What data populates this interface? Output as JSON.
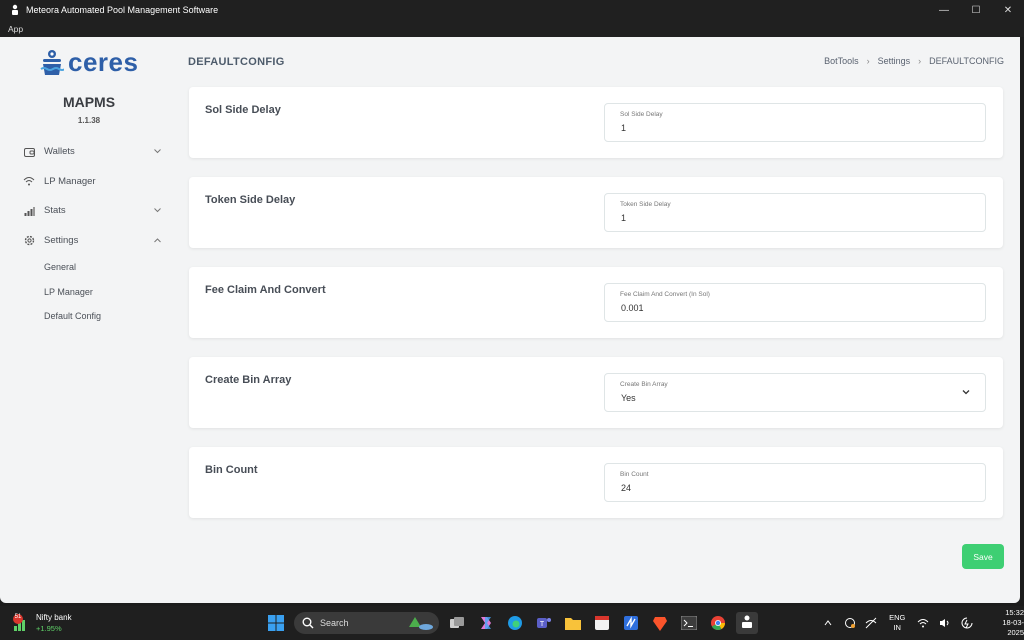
{
  "window": {
    "title": "Meteora Automated Pool Management Software"
  },
  "menu": {
    "app": "App"
  },
  "sidebar": {
    "brand": "ceres",
    "app_name": "MAPMS",
    "version": "1.1.38",
    "items": [
      {
        "label": "Wallets",
        "icon": "wallet-icon",
        "expandable": true
      },
      {
        "label": "LP Manager",
        "icon": "wifi-icon",
        "expandable": false
      },
      {
        "label": "Stats",
        "icon": "bar-chart-icon",
        "expandable": true
      },
      {
        "label": "Settings",
        "icon": "gear-icon",
        "expandable": true,
        "expanded": true
      }
    ],
    "subitems": [
      {
        "label": "General"
      },
      {
        "label": "LP Manager"
      },
      {
        "label": "Default Config"
      }
    ]
  },
  "header": {
    "title": "DEFAULTCONFIG",
    "breadcrumb": [
      "BotTools",
      "Settings",
      "DEFAULTCONFIG"
    ]
  },
  "settings": [
    {
      "label": "Sol Side Delay",
      "field_label": "Sol Side Delay",
      "value": "1",
      "type": "input"
    },
    {
      "label": "Token Side Delay",
      "field_label": "Token Side Delay",
      "value": "1",
      "type": "input"
    },
    {
      "label": "Fee Claim And Convert",
      "field_label": "Fee Claim And Convert (In Sol)",
      "value": "0.001",
      "type": "input"
    },
    {
      "label": "Create Bin Array",
      "field_label": "Create Bin Array",
      "value": "Yes",
      "type": "select"
    },
    {
      "label": "Bin Count",
      "field_label": "Bin Count",
      "value": "24",
      "type": "input"
    }
  ],
  "save_label": "Save",
  "colors": {
    "accent": "#3ecf73",
    "brand": "#2e5fa8"
  },
  "taskbar": {
    "widget": {
      "name": "Nifty bank",
      "change": "+1.95%",
      "badge": "51"
    },
    "search_placeholder": "Search",
    "language": {
      "top": "ENG",
      "bottom": "IN"
    },
    "time": "15:32",
    "date": "18-03-2025"
  }
}
